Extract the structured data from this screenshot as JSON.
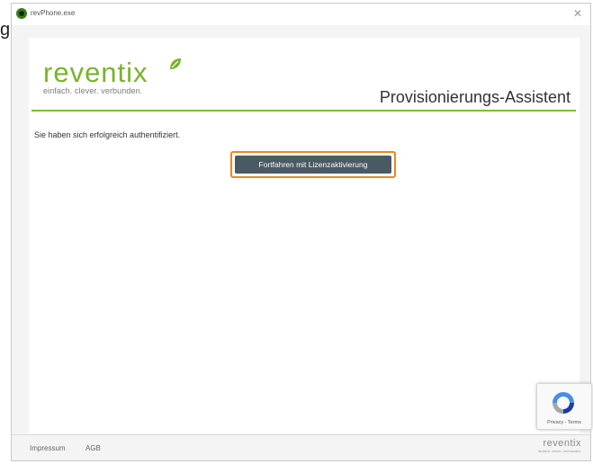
{
  "stray_text": "g",
  "window": {
    "title": "revPhone.exe",
    "close_symbol": "✕"
  },
  "header": {
    "logo_word": "reventix",
    "logo_tagline": "einfach. clever. verbunden.",
    "title": "Provisionierungs-Assistent"
  },
  "main": {
    "auth_message": "Sie haben sich erfolgreich authentifiziert.",
    "continue_label": "Fortfahren mit Lizenzaktivierung"
  },
  "captcha": {
    "links": "Privacy - Terms"
  },
  "footer": {
    "impressum": "Impressum",
    "agb": "AGB",
    "logo_word": "reventix",
    "logo_tagline": "einfach. clever. verbunden."
  },
  "colors": {
    "brand_green": "#78b42a",
    "button_bg": "#4a5a64",
    "focus_orange": "#e98a1c"
  }
}
